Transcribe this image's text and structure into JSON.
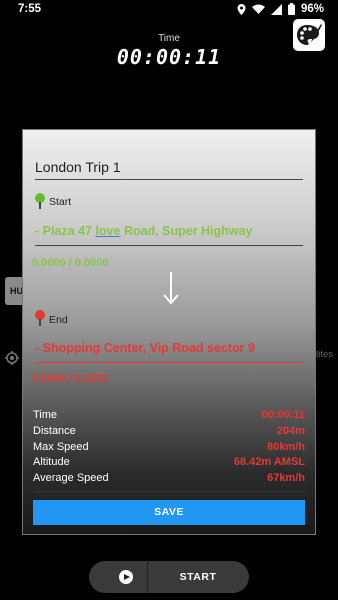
{
  "status_bar": {
    "time": "7:55",
    "battery": "96%"
  },
  "timer": {
    "label": "Time",
    "value": "00:00:11"
  },
  "side_tab_text": "HU",
  "satellites_text": "lites",
  "start_button_label": "START",
  "dialog": {
    "trip_name": "London Trip 1",
    "start": {
      "label": "Start",
      "address_prefix": "- Plaza 47 ",
      "address_underlined": "love",
      "address_suffix": " Road, Super Highway",
      "coords": "0.0000  /  0.0000"
    },
    "end": {
      "label": "End",
      "address": "- Shopping Center, Vip Road sector 9",
      "coords": "0.0000  /  0.0000"
    },
    "stats": [
      {
        "name": "Time",
        "value": "00:00:11"
      },
      {
        "name": "Distance",
        "value": "204m"
      },
      {
        "name": "Max Speed",
        "value": "80km/h"
      },
      {
        "name": "Altitude",
        "value": "68.42m AMSL"
      },
      {
        "name": "Average Speed",
        "value": "67km/h"
      }
    ],
    "save_label": "SAVE"
  },
  "colors": {
    "start_green": "#8bc34a",
    "end_red": "#e53935",
    "save_blue": "#2196f3"
  },
  "icons": [
    "location-icon",
    "wifi-icon",
    "signal-icon",
    "battery-icon",
    "palette-icon",
    "gps-icon",
    "play-icon",
    "arrow-down-icon",
    "start-pin-icon",
    "end-pin-icon"
  ]
}
